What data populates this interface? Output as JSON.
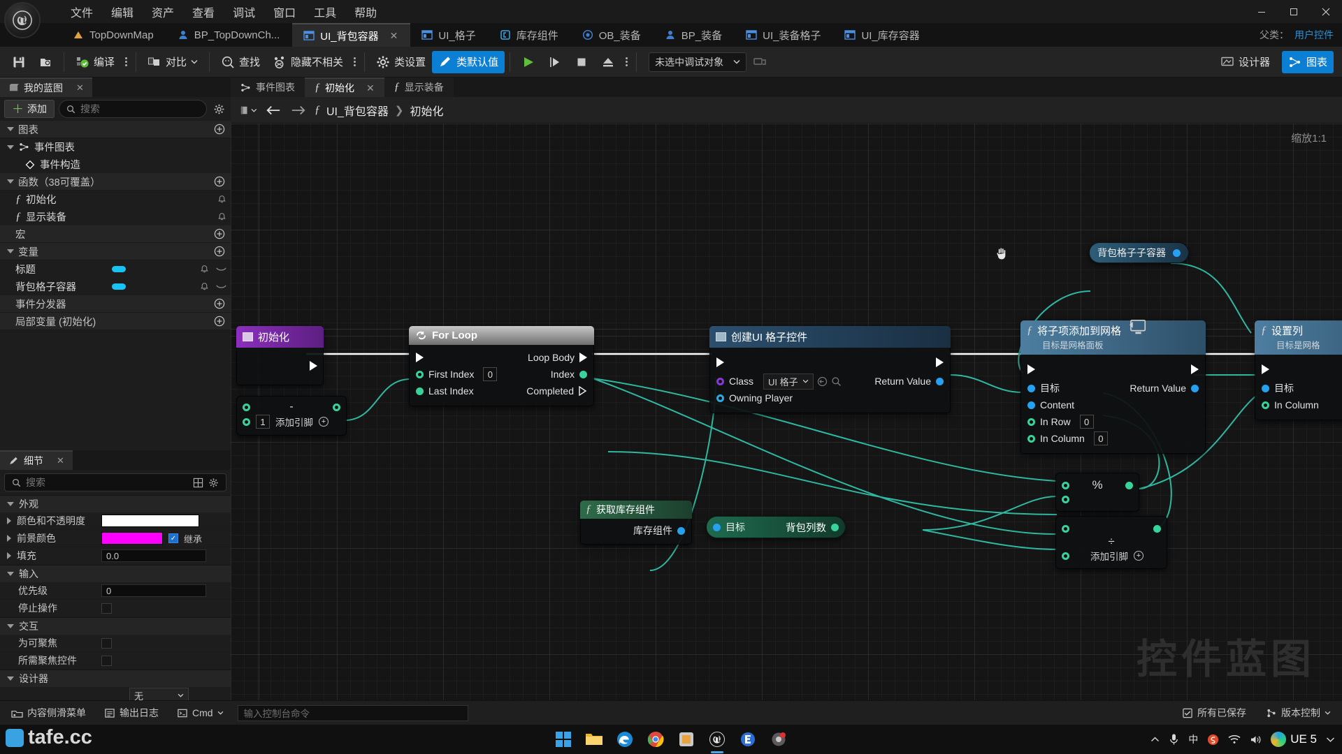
{
  "menu": {
    "items": [
      "文件",
      "编辑",
      "资产",
      "查看",
      "调试",
      "窗口",
      "工具",
      "帮助"
    ]
  },
  "window_controls": {
    "minimize": "—",
    "maximize": "▢",
    "close": "✕"
  },
  "asset_tabs": [
    {
      "label": "TopDownMap",
      "icon": "map-icon",
      "active": false,
      "closable": false
    },
    {
      "label": "BP_TopDownCh...",
      "icon": "blueprint-icon",
      "active": false,
      "closable": false
    },
    {
      "label": "UI_背包容器",
      "icon": "widget-icon",
      "active": true,
      "closable": true
    },
    {
      "label": "UI_格子",
      "icon": "widget-icon",
      "active": false,
      "closable": false
    },
    {
      "label": "库存组件",
      "icon": "component-icon",
      "active": false,
      "closable": false
    },
    {
      "label": "OB_装备",
      "icon": "object-icon",
      "active": false,
      "closable": false
    },
    {
      "label": "BP_装备",
      "icon": "blueprint-icon",
      "active": false,
      "closable": false
    },
    {
      "label": "UI_装备格子",
      "icon": "widget-icon",
      "active": false,
      "closable": false
    },
    {
      "label": "UI_库存容器",
      "icon": "widget-icon",
      "active": false,
      "closable": false
    }
  ],
  "parent_class": {
    "label": "父类：",
    "value": "用户控件"
  },
  "toolbar": {
    "save": "保存",
    "browse": "浏览",
    "compile": "编译",
    "diff": "对比",
    "find": "查找",
    "hide_unrelated": "隐藏不相关",
    "class_settings": "类设置",
    "class_defaults": "类默认值",
    "play": "播放",
    "step": "步进",
    "stop": "停止",
    "eject": "弹出",
    "debug_object": "未选中调试对象",
    "designer": "设计器",
    "graph": "图表"
  },
  "my_blueprint": {
    "title": "我的蓝图",
    "add_button": "添加",
    "search_placeholder": "搜索",
    "sections": [
      {
        "label": "图表",
        "type": "section"
      },
      {
        "label": "事件图表",
        "type": "item-graph",
        "icon": "graph-icon"
      },
      {
        "label": "事件构造",
        "type": "item-event",
        "icon": "diamond-icon"
      },
      {
        "label": "函数（38可覆盖）",
        "type": "section"
      },
      {
        "label": "初始化",
        "type": "item-func",
        "icon": "function-icon"
      },
      {
        "label": "显示装备",
        "type": "item-func",
        "icon": "function-icon"
      },
      {
        "label": "宏",
        "type": "section-plain"
      },
      {
        "label": "变量",
        "type": "section"
      },
      {
        "label": "标题",
        "type": "item-var",
        "pill_color": "#17c3f0"
      },
      {
        "label": "背包格子容器",
        "type": "item-var",
        "pill_color": "#17c3f0"
      },
      {
        "label": "事件分发器",
        "type": "section-plain"
      },
      {
        "label": "局部变量 (初始化)",
        "type": "section-plain"
      }
    ]
  },
  "details": {
    "title": "细节",
    "search_placeholder": "搜索",
    "groups": [
      {
        "name": "外观",
        "rows": [
          {
            "label": "颜色和不透明度",
            "type": "color",
            "value": "#ffffff",
            "expandable": true
          },
          {
            "label": "前景颜色",
            "type": "color-inherit",
            "value": "#ff00ff",
            "inherit_label": "继承",
            "inherit_checked": true,
            "expandable": true
          },
          {
            "label": "填充",
            "type": "number",
            "value": "0.0",
            "expandable": true
          }
        ]
      },
      {
        "name": "输入",
        "rows": [
          {
            "label": "优先级",
            "type": "number",
            "value": "0"
          },
          {
            "label": "停止操作",
            "type": "checkbox"
          }
        ]
      },
      {
        "name": "交互",
        "rows": [
          {
            "label": "为可聚焦",
            "type": "checkbox"
          },
          {
            "label": "所需聚焦控件",
            "type": "checkbox"
          }
        ]
      },
      {
        "name": "设计器",
        "rows": [
          {
            "label": "",
            "type": "select",
            "value": "无"
          }
        ]
      }
    ]
  },
  "graph_tabs": [
    {
      "label": "事件图表",
      "icon": "graph-icon",
      "active": false,
      "closable": false
    },
    {
      "label": "初始化",
      "icon": "function-icon",
      "active": true,
      "closable": true
    },
    {
      "label": "显示装备",
      "icon": "function-icon",
      "active": false,
      "closable": false
    }
  ],
  "breadcrumb": {
    "root": "UI_背包容器",
    "sep": "❯",
    "current": "初始化",
    "icon": "function-icon"
  },
  "canvas": {
    "zoom_label": "缩放1:1",
    "watermark": "控件蓝图"
  },
  "nodes": {
    "entry": {
      "title": "初始化",
      "header_color": "#8b2fbd"
    },
    "bag_grid_var": {
      "title": "背包格子子容器"
    },
    "for_loop": {
      "title": "For Loop",
      "inputs": [
        {
          "label": "First Index",
          "value": "0",
          "pin": "int"
        },
        {
          "label": "Last Index",
          "value": "",
          "pin": "int"
        }
      ],
      "outputs": [
        {
          "label": "Loop Body",
          "pin": "exec"
        },
        {
          "label": "Index",
          "pin": "int"
        },
        {
          "label": "Completed",
          "pin": "exec"
        }
      ]
    },
    "subtract": {
      "symbol": "-",
      "add_pin": "添加引脚",
      "value": "1"
    },
    "create_widget": {
      "title": "创建UI 格子控件",
      "class_label": "Class",
      "class_value": "UI 格子",
      "owning_player": "Owning Player",
      "return_value": "Return Value"
    },
    "add_child_grid": {
      "title": "将子项添加到网格",
      "subtitle": "目标是网格面板",
      "inputs": [
        {
          "label": "目标",
          "pin": "object"
        },
        {
          "label": "Content",
          "pin": "object"
        },
        {
          "label": "In Row",
          "value": "0",
          "pin": "int"
        },
        {
          "label": "In Column",
          "value": "0",
          "pin": "int"
        }
      ],
      "outputs": [
        {
          "label": "Return Value",
          "pin": "object"
        }
      ]
    },
    "set_column": {
      "title": "设置列",
      "subtitle": "目标是网格",
      "inputs": [
        {
          "label": "目标",
          "pin": "object"
        },
        {
          "label": "In Column",
          "pin": "int"
        }
      ]
    },
    "get_inventory": {
      "title": "获取库存组件",
      "output": "库存组件"
    },
    "bag_list_count": {
      "target": "目标",
      "label": "背包列数"
    },
    "modulo": {
      "symbol": "%"
    },
    "divide": {
      "symbol": "÷",
      "add_pin": "添加引脚"
    }
  },
  "statusbar": {
    "content_drawer": "内容侧滑菜单",
    "output_log": "输出日志",
    "cmd_label": "Cmd",
    "cmd_placeholder": "输入控制台命令",
    "all_saved": "所有已保存",
    "source_control": "版本控制"
  },
  "taskbar": {
    "brand": "tafe.cc",
    "ue_label": "UE 5",
    "ime": "中",
    "apps": [
      {
        "name": "start-button"
      },
      {
        "name": "file-explorer"
      },
      {
        "name": "edge-browser"
      },
      {
        "name": "chrome-browser"
      },
      {
        "name": "store-app"
      },
      {
        "name": "unreal-editor"
      },
      {
        "name": "epic-launcher"
      },
      {
        "name": "recording-app"
      }
    ]
  },
  "colors": {
    "accent_blue": "#0b7fd4",
    "exec_white": "#ffffff",
    "int_green": "#37d39a",
    "object_blue": "#26a0f0",
    "class_purple": "#8b36d6",
    "wire_teal": "#22b5a8"
  }
}
